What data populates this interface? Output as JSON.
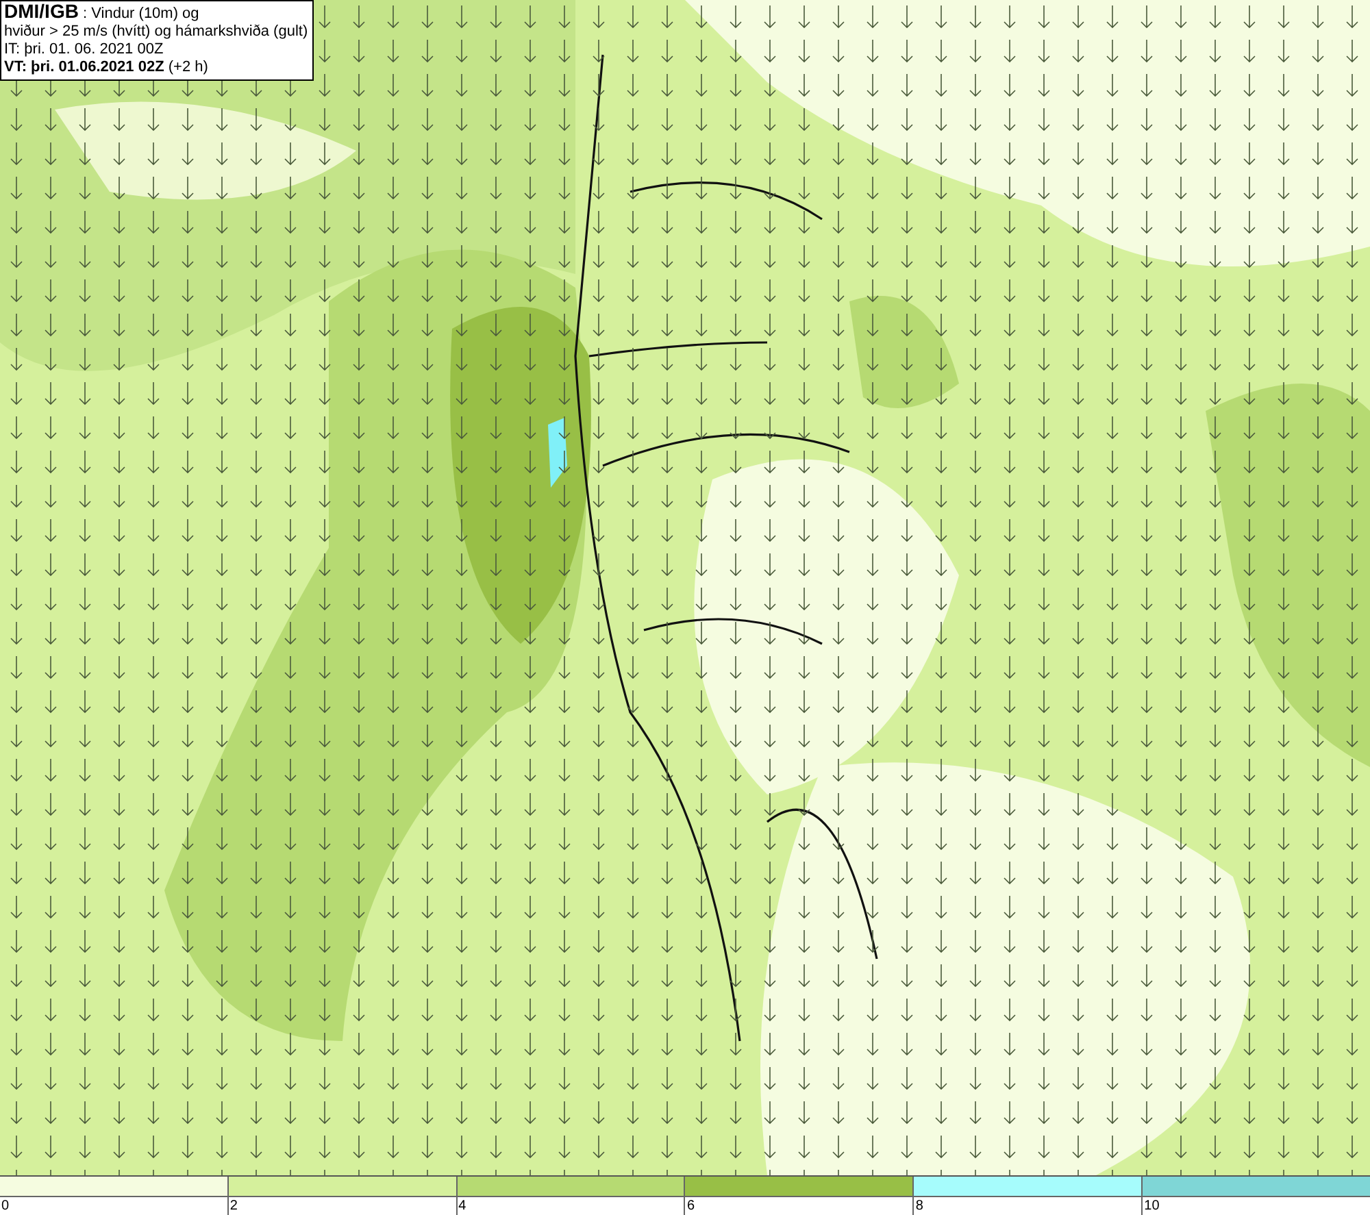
{
  "title_box": {
    "lines": [
      "**DMI/IGB** : Vindur (10m) og",
      "hviður > 25 m/s (hvítt) og hámarkshviða (gult)",
      "IT: þri. 01. 06. 2021 00Z",
      "**VT: þri. 01.06.2021 02Z** (+2 h)"
    ]
  },
  "legend": {
    "segments": [
      {
        "label": "0",
        "color": "#f5fce0"
      },
      {
        "label": "2",
        "color": "#d5f09c"
      },
      {
        "label": "4",
        "color": "#b6da72"
      },
      {
        "label": "6",
        "color": "#98bf46"
      },
      {
        "label": "8",
        "color": "#a6fcfc"
      },
      {
        "label": "10",
        "color": "#7fd6d6"
      }
    ]
  }
}
